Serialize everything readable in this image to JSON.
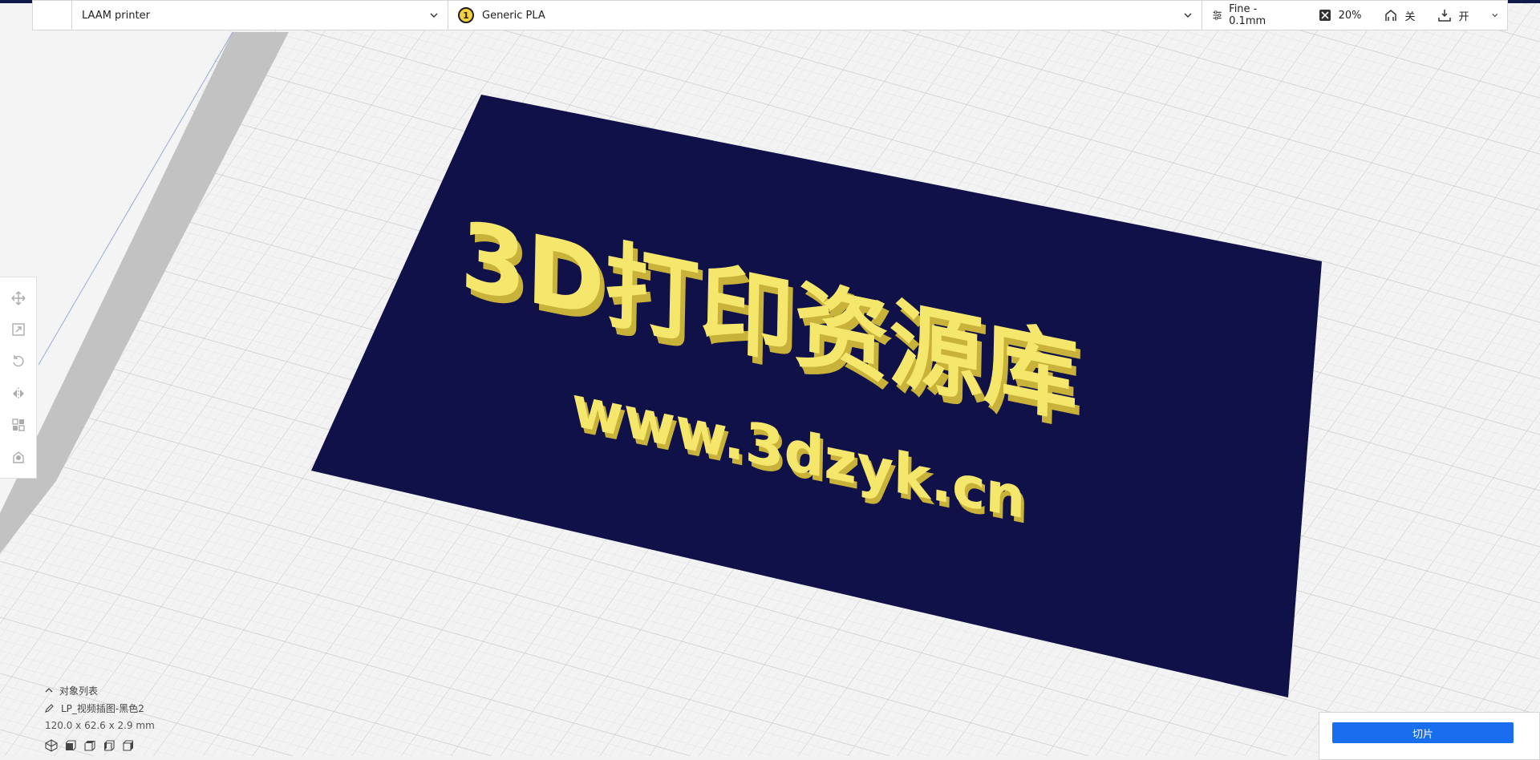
{
  "header": {
    "printer": "LAAM printer",
    "material_index": "1",
    "material": "Generic PLA",
    "profile": "Fine - 0.1mm",
    "infill": "20%",
    "support": "关",
    "adhesion": "开"
  },
  "scene": {
    "model_title": "3D打印资源库",
    "model_url": "www.3dzyk.cn",
    "plate_color": "#11114a",
    "text_color": "#f5e66c"
  },
  "object_list": {
    "title": "对象列表",
    "object_name": "LP_视频插图-黑色2",
    "dimensions": "120.0 x 62.6 x 2.9 mm"
  },
  "actions": {
    "slice": "切片"
  },
  "colors": {
    "accent": "#196ef0",
    "header_stripe": "#0f1a4a"
  }
}
